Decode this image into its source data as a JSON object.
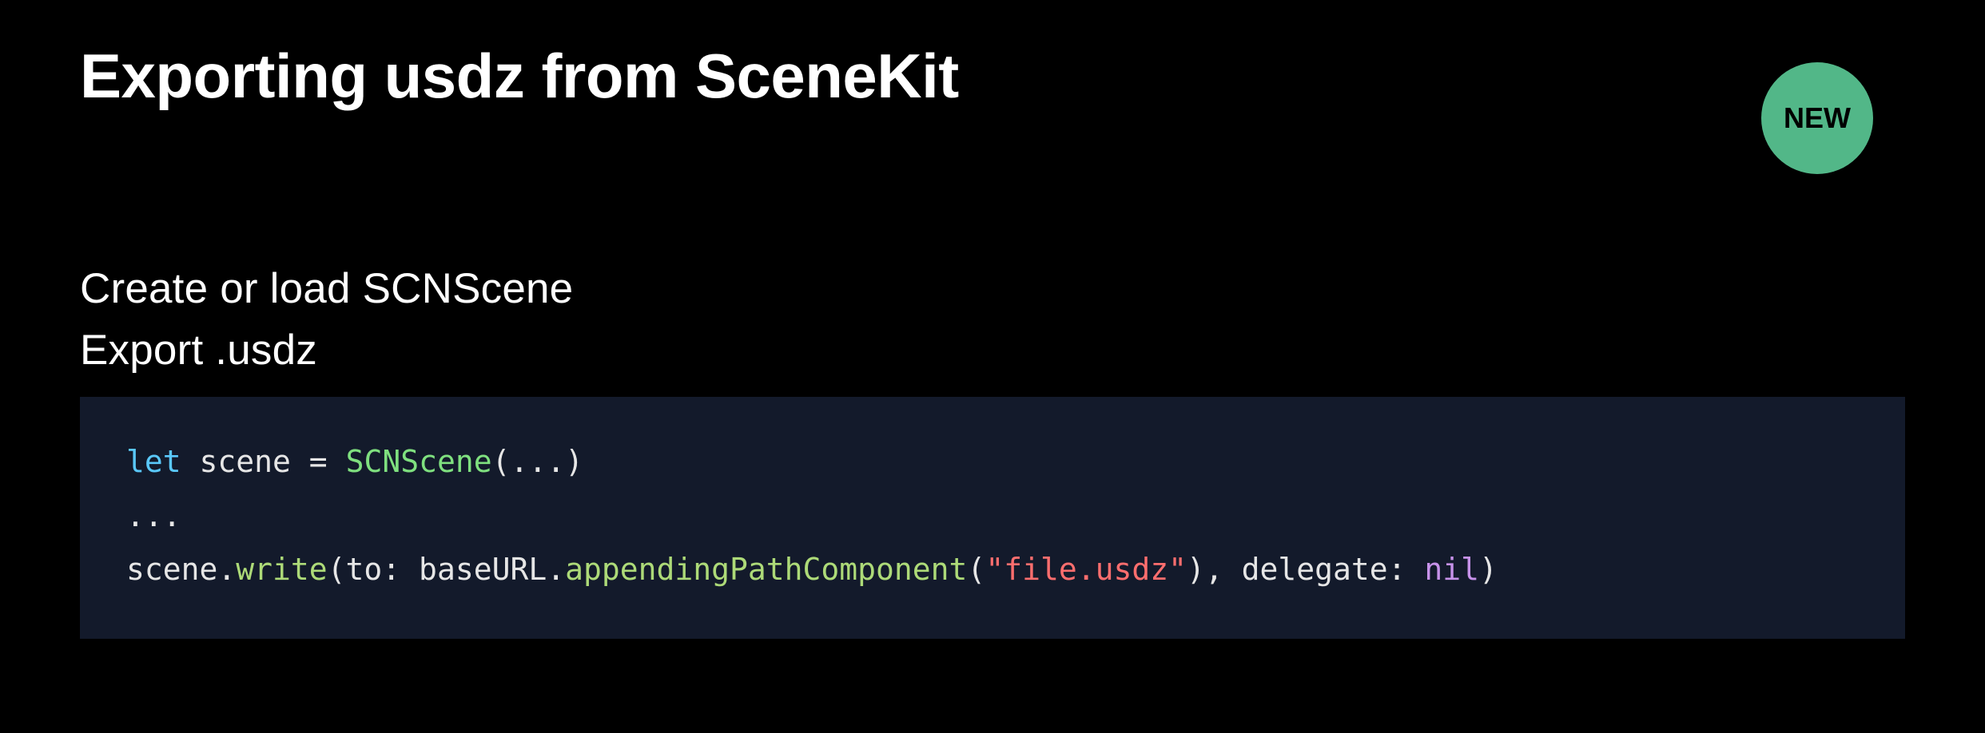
{
  "slide": {
    "title": "Exporting usdz from SceneKit",
    "badge": {
      "label": "NEW",
      "bg": "#52b788"
    },
    "subtitles": [
      "Create or load SCNScene",
      "Export .usdz"
    ],
    "code": {
      "line1": {
        "kw_let": "let",
        "space1": " ",
        "var": "scene",
        "eq": " = ",
        "type": "SCNScene",
        "rest": "(...)"
      },
      "line2": "...",
      "line3": {
        "obj": "scene.",
        "method1": "write",
        "open1": "(to: baseURL.",
        "method2": "appendingPathComponent",
        "open2": "(",
        "str": "\"file.usdz\"",
        "close2": "), delegate: ",
        "nil": "nil",
        "close1": ")"
      }
    }
  }
}
